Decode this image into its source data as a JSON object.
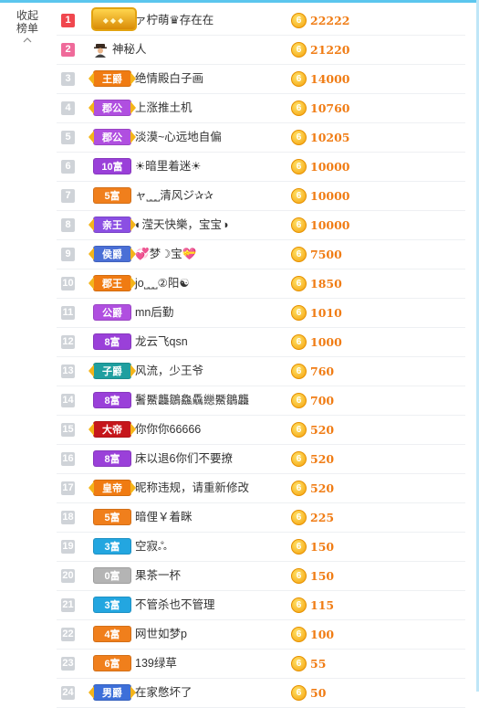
{
  "colors": {
    "rank_top1": "#f0474e",
    "rank_top2": "#ef6a9a",
    "rank_default": "#cfd3d8",
    "score": "#f07c14",
    "coin": "#f5a00a",
    "accent_bar": "#5bc6ee"
  },
  "sidebar": {
    "collapse_label": "收起\n榜单",
    "chevron_icon": "chevron-up-icon"
  },
  "coin_icon": {
    "label": "6",
    "icon": "coin-icon"
  },
  "rows": [
    {
      "rank": "1",
      "badge": "",
      "badge_style": "big",
      "badge_color": "#e9a30b",
      "name": "ァ柠萌♛存在在",
      "score": "22222"
    },
    {
      "rank": "2",
      "badge": "",
      "badge_style": "avatar",
      "badge_color": "",
      "name": "神秘人",
      "score": "21220"
    },
    {
      "rank": "3",
      "badge": "王爵",
      "badge_style": "crown",
      "badge_color": "#f07b12",
      "name": "绝情殿白子画",
      "score": "14000"
    },
    {
      "rank": "4",
      "badge": "郡公",
      "badge_style": "crown",
      "badge_color": "#b04fe0",
      "name": "上涨推土机",
      "score": "10760"
    },
    {
      "rank": "5",
      "badge": "郡公",
      "badge_style": "crown",
      "badge_color": "#b04fe0",
      "name": "淡漠~心远地自偏",
      "score": "10205"
    },
    {
      "rank": "6",
      "badge": "10富",
      "badge_style": "plain",
      "badge_color": "#9a40d9",
      "name": "☀暗里着迷☀",
      "score": "10000"
    },
    {
      "rank": "7",
      "badge": "5富",
      "badge_style": "plain",
      "badge_color": "#f07f1c",
      "name": "ャ˽˽˽清风ジ✰✰",
      "score": "10000"
    },
    {
      "rank": "8",
      "badge": "亲王",
      "badge_style": "crown",
      "badge_color": "#8b4fe3",
      "name": "◐滢天快樂，宝宝◑",
      "score": "10000"
    },
    {
      "rank": "9",
      "badge": "侯爵",
      "badge_style": "crown",
      "badge_color": "#4a6fd6",
      "name": "💞梦☽宝💝",
      "score": "7500"
    },
    {
      "rank": "10",
      "badge": "郡王",
      "badge_style": "crown",
      "badge_color": "#f07b12",
      "name": "jo˽˽˽②阳☯",
      "score": "1850"
    },
    {
      "rank": "11",
      "badge": "公爵",
      "badge_style": "plain",
      "badge_color": "#b04fe0",
      "name": "mn后勤",
      "score": "1010"
    },
    {
      "rank": "12",
      "badge": "8富",
      "badge_style": "plain",
      "badge_color": "#9a40d9",
      "name": "龙云飞qsn",
      "score": "1000"
    },
    {
      "rank": "13",
      "badge": "子爵",
      "badge_style": "crown",
      "badge_color": "#1f9fa0",
      "name": "风流，少王爷",
      "score": "760"
    },
    {
      "rank": "14",
      "badge": "8富",
      "badge_style": "plain",
      "badge_color": "#9a40d9",
      "name": "鬐鱀龘鶵鱻驫纞鱀鶵龘",
      "score": "700"
    },
    {
      "rank": "15",
      "badge": "大帝",
      "badge_style": "crown",
      "badge_color": "#c6161b",
      "name": "你你你66666",
      "score": "520"
    },
    {
      "rank": "16",
      "badge": "8富",
      "badge_style": "plain",
      "badge_color": "#9a40d9",
      "name": "床以退6你们不要撩",
      "score": "520"
    },
    {
      "rank": "17",
      "badge": "皇帝",
      "badge_style": "crown",
      "badge_color": "#f07b12",
      "name": "昵称违规，请重新修改",
      "score": "520"
    },
    {
      "rank": "18",
      "badge": "5富",
      "badge_style": "plain",
      "badge_color": "#f07f1c",
      "name": "暗俚￥着眯",
      "score": "225"
    },
    {
      "rank": "19",
      "badge": "3富",
      "badge_style": "plain",
      "badge_color": "#23a6e0",
      "name": "空寂ஃ",
      "score": "150"
    },
    {
      "rank": "20",
      "badge": "0富",
      "badge_style": "plain",
      "badge_color": "#b4b4b4",
      "name": "果茶一杯",
      "score": "150"
    },
    {
      "rank": "21",
      "badge": "3富",
      "badge_style": "plain",
      "badge_color": "#23a6e0",
      "name": "不管杀也不管理",
      "score": "115"
    },
    {
      "rank": "22",
      "badge": "4富",
      "badge_style": "plain",
      "badge_color": "#f07f1c",
      "name": "网世如梦p",
      "score": "100"
    },
    {
      "rank": "23",
      "badge": "6富",
      "badge_style": "plain",
      "badge_color": "#f07f1c",
      "name": "139绿草",
      "score": "55"
    },
    {
      "rank": "24",
      "badge": "男爵",
      "badge_style": "crown",
      "badge_color": "#3d6fd9",
      "name": "在家憋坏了",
      "score": "50"
    }
  ]
}
